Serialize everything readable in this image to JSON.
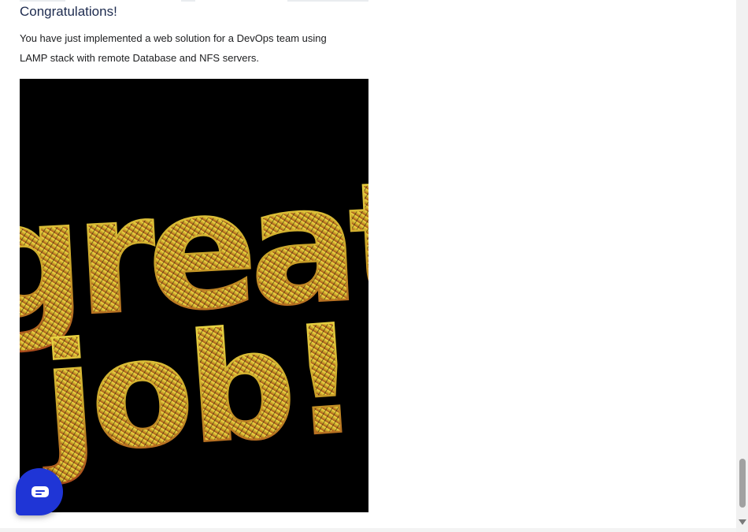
{
  "article": {
    "heading": "Congratulations!",
    "paragraph_line1": "You have just implemented a web solution for a DevOps team using",
    "paragraph_line2": "LAMP stack with remote Database and NFS servers.",
    "image": {
      "line1": "great",
      "line2": "job!",
      "background": "#000000",
      "text_gradient": [
        "#f2e24a",
        "#c9a228",
        "#a8481c"
      ]
    }
  },
  "chat_widget": {
    "icon": "chat-bubble-icon",
    "color": "#1f35d6"
  },
  "scrollbar": {
    "icon": "scroll-down-arrow-icon"
  }
}
